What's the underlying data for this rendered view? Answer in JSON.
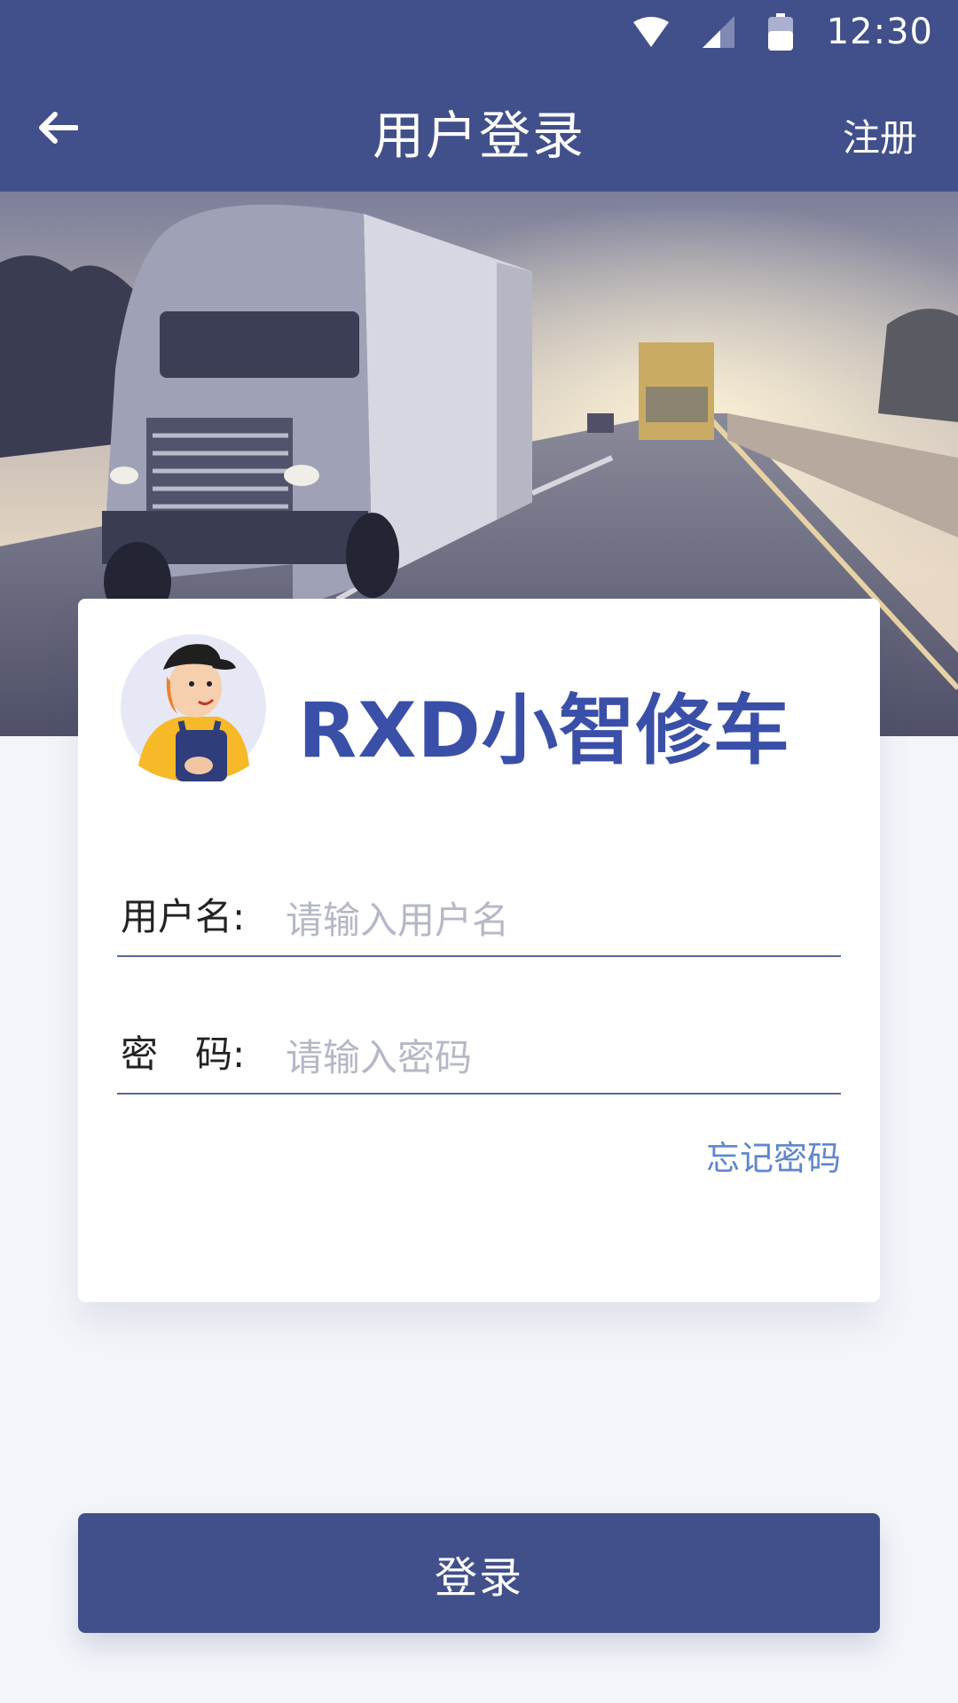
{
  "status_bar": {
    "time": "12:30",
    "icons": [
      "wifi-icon",
      "cell-signal-icon",
      "battery-icon"
    ]
  },
  "nav": {
    "back_icon": "arrow-left-icon",
    "title": "用户登录",
    "register_label": "注册"
  },
  "hero": {
    "image": "trucks-on-highway-photo"
  },
  "login_card": {
    "avatar": "mechanic-mascot-avatar",
    "brand_name": "RXD小智修车",
    "username": {
      "label": "用户名:",
      "placeholder": "请输入用户名",
      "value": ""
    },
    "password": {
      "label": "密　码:",
      "placeholder": "请输入密码",
      "value": ""
    },
    "forgot_password_label": "忘记密码"
  },
  "login_button_label": "登录",
  "colors": {
    "primary": "#41508a",
    "brand_text": "#3a4fa8",
    "link": "#5f86cf",
    "background": "#f4f5fa"
  }
}
